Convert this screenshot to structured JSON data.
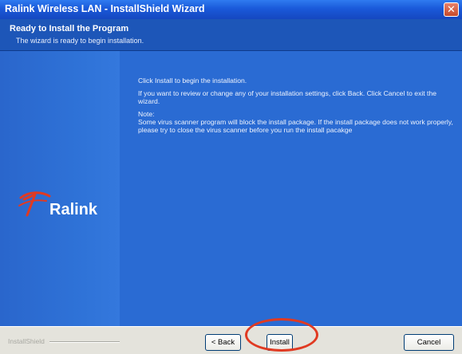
{
  "window": {
    "title": "Ralink Wireless LAN - InstallShield Wizard",
    "close_glyph": "✕"
  },
  "header": {
    "title": "Ready to Install the Program",
    "subtitle": "The wizard is ready to begin installation."
  },
  "sidebar": {
    "logo_text": "Ralink",
    "logo_icon": "ralink-swoosh-icon"
  },
  "content": {
    "line1": "Click Install to begin the installation.",
    "line2": "If you want to review or change any of your installation settings, click Back. Click Cancel to exit the wizard.",
    "note_label": "Note:",
    "note_text": "Some virus scanner program will block the install package. If the install package does not work properly, please try to close the virus scanner before you run the install pacakge"
  },
  "footer": {
    "brandmark": "InstallShield",
    "back_label": "< Back",
    "install_label": "Install",
    "cancel_label": "Cancel"
  },
  "colors": {
    "titlebar": "#1a59d9",
    "body": "#2a6bd3",
    "footer": "#e4e3dc",
    "highlight": "#e03a22"
  }
}
